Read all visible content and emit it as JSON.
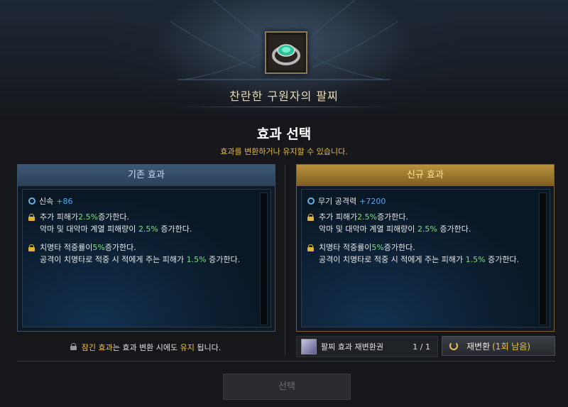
{
  "item": {
    "name": "찬란한 구원자의 팔찌",
    "icon": "bracelet-icon"
  },
  "header": {
    "title": "효과 선택",
    "subtitle": "효과를 변환하거나 유지할 수 있습니다."
  },
  "current_panel": {
    "label": "기존 효과",
    "stat": {
      "name": "신속",
      "value": "+86"
    },
    "effects": [
      {
        "line1_pre": "추가 피해가 ",
        "line1_val": "2.5%",
        "line1_post": " 증가한다.",
        "line2_pre": "악마 및 대악마 계열 피해량이 ",
        "line2_val": "2.5%",
        "line2_post": " 증가한다."
      },
      {
        "line1_pre": "치명타 적중률이 ",
        "line1_val": "5%",
        "line1_post": " 증가한다.",
        "line2_pre": "공격이 치명타로 적중 시 적에게 주는 피해가 ",
        "line2_val": "1.5%",
        "line2_post": " 증가한다."
      }
    ]
  },
  "new_panel": {
    "label": "신규 효과",
    "stat": {
      "name": "무기 공격력",
      "value": "+7200"
    },
    "effects": [
      {
        "line1_pre": "추가 피해가 ",
        "line1_val": "2.5%",
        "line1_post": " 증가한다.",
        "line2_pre": "악마 및 대악마 계열 피해량이 ",
        "line2_val": "2.5%",
        "line2_post": " 증가한다."
      },
      {
        "line1_pre": "치명타 적중률이 ",
        "line1_val": "5%",
        "line1_post": " 증가한다.",
        "line2_pre": "공격이 치명타로 적중 시 적에게 주는 피해가 ",
        "line2_val": "1.5%",
        "line2_post": " 증가한다."
      }
    ]
  },
  "footnote": {
    "part1": "잠긴 효과",
    "part2": "는 효과 변환 시에도 ",
    "part3": "유지",
    "part4": " 됩니다."
  },
  "reroll_ticket": {
    "label": "팔찌 효과 재변환권",
    "count": "1 / 1"
  },
  "reroll_button": {
    "label": "재변환",
    "remaining": "(1회 남음)"
  },
  "select_button": {
    "label": "선택"
  }
}
